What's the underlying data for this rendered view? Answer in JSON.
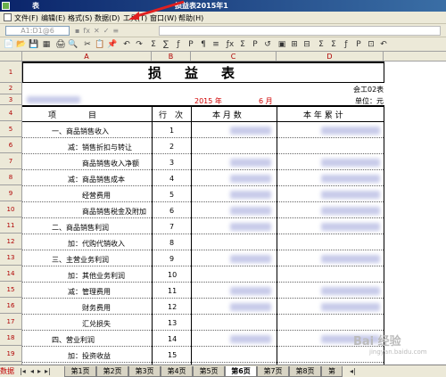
{
  "window": {
    "title_left": "表",
    "title_center": "损益表2015年1"
  },
  "menu": [
    {
      "label": "文件(F)"
    },
    {
      "label": "编辑(E)"
    },
    {
      "label": "格式(S)"
    },
    {
      "label": "数据(D)"
    },
    {
      "label": "工具(T)"
    },
    {
      "label": "窗口(W)"
    },
    {
      "label": "帮助(H)"
    }
  ],
  "formula": {
    "cell_ref": "A1:D1@6",
    "icons": [
      "▪",
      "fx",
      "✕",
      "✓",
      "≡"
    ]
  },
  "toolbar": {
    "icons": [
      "📄",
      "📂",
      "💾",
      "▦",
      "🖨",
      "🔍",
      "✂",
      "📋",
      "📌",
      "↶",
      "↷",
      "Σ",
      "∑",
      "ƒ",
      "P",
      "¶",
      "≡",
      "ƒx",
      "Σ",
      "P",
      "↺",
      "▣",
      "⊞",
      "⊟",
      "Σ",
      "Σ",
      "ƒ",
      "P",
      "⊡",
      "↶"
    ]
  },
  "columns": [
    "A",
    "B",
    "C",
    "D"
  ],
  "rows": [
    "1",
    "2",
    "3",
    "4",
    "5",
    "6",
    "7",
    "8",
    "9",
    "10",
    "11",
    "12",
    "13",
    "14",
    "15",
    "16",
    "17",
    "18",
    "19",
    "20"
  ],
  "report": {
    "title": "损益表",
    "form_code": "会工02表",
    "unit": "单位：元",
    "year": "2015 年",
    "month": "6 月",
    "headers": {
      "item": "项　　　　目",
      "line": "行　次",
      "current": "本 月 数",
      "ytd": "本 年 累 计"
    },
    "items": [
      {
        "label": "一、商品销售收入",
        "line": "1"
      },
      {
        "label": "减：销售折扣与转让",
        "line": "2"
      },
      {
        "label": "商品销售收入净额",
        "line": "3"
      },
      {
        "label": "减：商品销售成本",
        "line": "4"
      },
      {
        "label": "经营费用",
        "line": "5"
      },
      {
        "label": "商品销售税金及附加",
        "line": "6"
      },
      {
        "label": "二、商品销售利润",
        "line": "7"
      },
      {
        "label": "加：代购代销收入",
        "line": "8"
      },
      {
        "label": "三、主营业务利润",
        "line": "9"
      },
      {
        "label": "加：其他业务利润",
        "line": "10"
      },
      {
        "label": "减：管理费用",
        "line": "11"
      },
      {
        "label": "财务费用",
        "line": "12"
      },
      {
        "label": "汇兑损失",
        "line": "13"
      },
      {
        "label": "四、营业利润",
        "line": "14"
      },
      {
        "label": "加：投资收益",
        "line": "15"
      }
    ]
  },
  "tabs": {
    "first": "数据",
    "sheets": [
      "第1页",
      "第2页",
      "第3页",
      "第4页",
      "第5页",
      "第6页",
      "第7页",
      "第8页",
      "第"
    ],
    "active": "第6页"
  },
  "watermark": {
    "text": "Bai 经验",
    "sub": "jingyan.baidu.com"
  }
}
